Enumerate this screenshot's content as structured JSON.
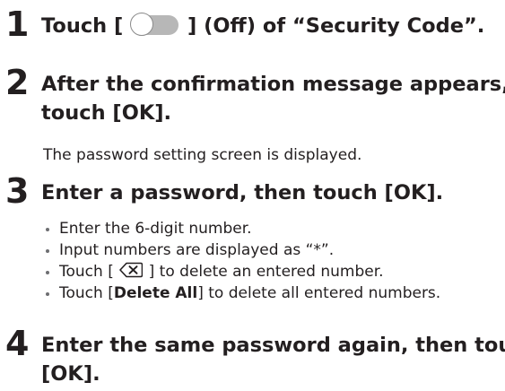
{
  "steps": [
    {
      "number": "1",
      "title_before": "Touch [",
      "title_after": "] (Off) of “Security Code”.",
      "toggle_state": "off"
    },
    {
      "number": "2",
      "title_line1": "After the confirmation message appears,",
      "title_line2": "touch [OK].",
      "description": "The password setting screen is displayed."
    },
    {
      "number": "3",
      "title": "Enter a password, then touch [OK].",
      "bullets": {
        "b1": "Enter the 6-digit number.",
        "b2": "Input numbers are displayed as “*”.",
        "b3_before": "Touch [",
        "b3_after": "] to delete an entered number.",
        "b3_icon": "backspace-key-icon",
        "b4_before": "Touch [",
        "b4_bold": "Delete All",
        "b4_after": "] to delete all entered numbers."
      }
    },
    {
      "number": "4",
      "title_line1": "Enter the same password again, then touch",
      "title_line2": "[OK]."
    }
  ],
  "colors": {
    "text": "#231f20",
    "toggle_track": "#b7b7b7",
    "bullet": "#6d6e71"
  }
}
